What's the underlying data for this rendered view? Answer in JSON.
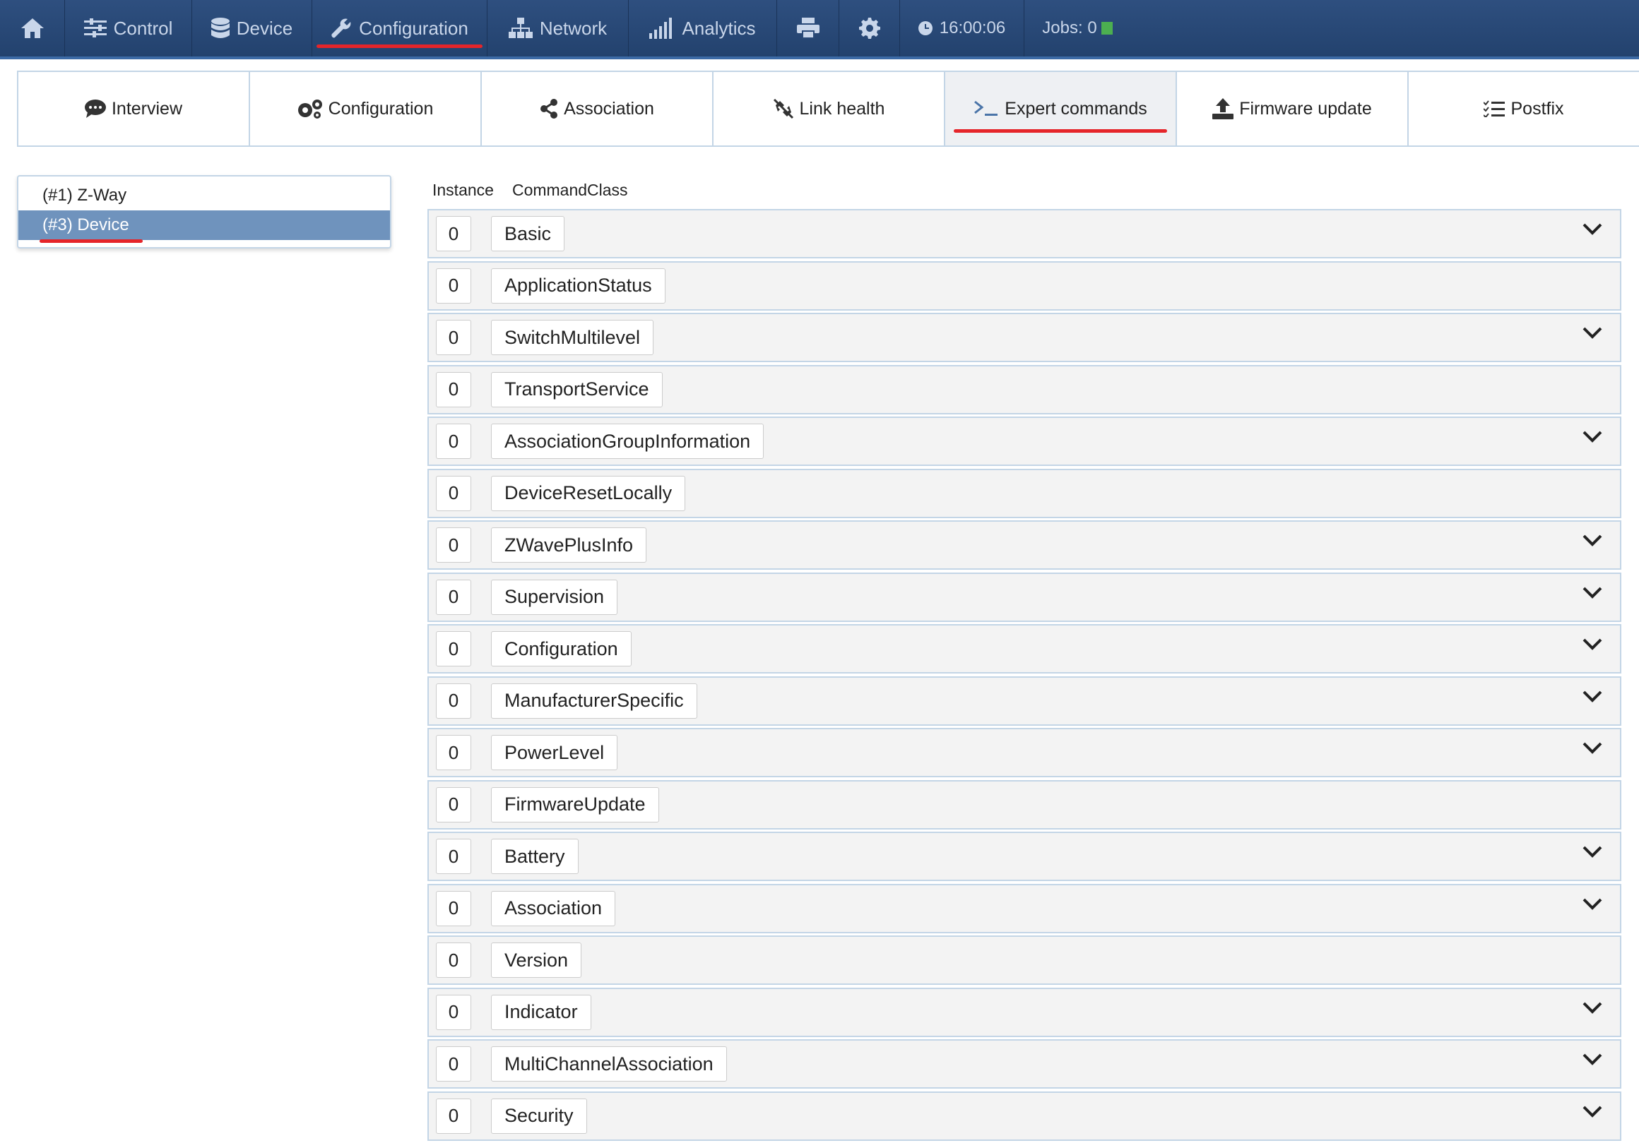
{
  "topnav": {
    "control": "Control",
    "device": "Device",
    "configuration": "Configuration",
    "network": "Network",
    "analytics": "Analytics",
    "time": "16:00:06",
    "jobs": "Jobs: 0"
  },
  "subtabs": {
    "interview": "Interview",
    "configuration": "Configuration",
    "association": "Association",
    "link_health": "Link health",
    "expert_commands": "Expert commands",
    "firmware_update": "Firmware update",
    "postfix": "Postfix"
  },
  "devices": [
    {
      "label": "(#1) Z-Way"
    },
    {
      "label": "(#3) Device"
    }
  ],
  "table": {
    "col_instance": "Instance",
    "col_commandclass": "CommandClass",
    "rows": [
      {
        "instance": "0",
        "name": "Basic",
        "expandable": true
      },
      {
        "instance": "0",
        "name": "ApplicationStatus",
        "expandable": false
      },
      {
        "instance": "0",
        "name": "SwitchMultilevel",
        "expandable": true
      },
      {
        "instance": "0",
        "name": "TransportService",
        "expandable": false
      },
      {
        "instance": "0",
        "name": "AssociationGroupInformation",
        "expandable": true
      },
      {
        "instance": "0",
        "name": "DeviceResetLocally",
        "expandable": false
      },
      {
        "instance": "0",
        "name": "ZWavePlusInfo",
        "expandable": true
      },
      {
        "instance": "0",
        "name": "Supervision",
        "expandable": true
      },
      {
        "instance": "0",
        "name": "Configuration",
        "expandable": true
      },
      {
        "instance": "0",
        "name": "ManufacturerSpecific",
        "expandable": true
      },
      {
        "instance": "0",
        "name": "PowerLevel",
        "expandable": true
      },
      {
        "instance": "0",
        "name": "FirmwareUpdate",
        "expandable": false
      },
      {
        "instance": "0",
        "name": "Battery",
        "expandable": true
      },
      {
        "instance": "0",
        "name": "Association",
        "expandable": true
      },
      {
        "instance": "0",
        "name": "Version",
        "expandable": false
      },
      {
        "instance": "0",
        "name": "Indicator",
        "expandable": true
      },
      {
        "instance": "0",
        "name": "MultiChannelAssociation",
        "expandable": true
      },
      {
        "instance": "0",
        "name": "Security",
        "expandable": true
      }
    ]
  },
  "colors": {
    "accent_underline": "#e5252a",
    "topbar": "#2e4f7f",
    "selected_device": "#6f93bd",
    "jobs_status": "#4caf50"
  }
}
